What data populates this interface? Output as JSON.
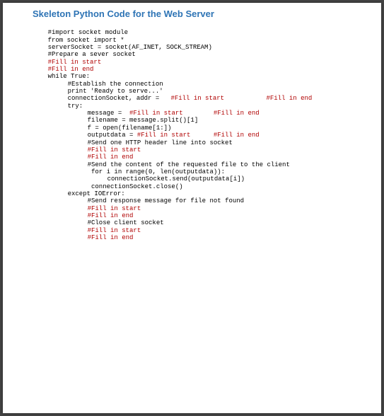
{
  "title": "Skeleton Python Code for the Web Server",
  "code": {
    "l1": "#import socket module",
    "l2": "from socket import *",
    "l3": "serverSocket = socket(AF_INET, SOCK_STREAM)",
    "l4": "#Prepare a sever socket",
    "l5": "#Fill in start",
    "l6": "#Fill in end",
    "l7": "while True:",
    "l8": "#Establish the connection",
    "l9": "print 'Ready to serve...'",
    "l10a": "connectionSocket, addr =   ",
    "l10b": "#Fill in start",
    "l10c": "           ",
    "l10d": "#Fill in end",
    "l11": "try:",
    "l12a": "message =  ",
    "l12b": "#Fill in start",
    "l12c": "        ",
    "l12d": "#Fill in end",
    "l13": "filename = message.split()[1]",
    "l14": "f = open(filename[1:])",
    "l15a": "outputdata = ",
    "l15b": "#Fill in start",
    "l15c": "      ",
    "l15d": "#Fill in end",
    "l16": "#Send one HTTP header line into socket",
    "l17": "#Fill in start",
    "l18": "#Fill in end",
    "l19": "#Send the content of the requested file to the client",
    "l20": " for i in range(0, len(outputdata)):",
    "l21": "connectionSocket.send(outputdata[i])",
    "l22": " connectionSocket.close()",
    "l23": "except IOError:",
    "l24": "#Send response message for file not found",
    "l25": "#Fill in start",
    "l26": "#Fill in end",
    "l27": "#Close client socket",
    "l28": "#Fill in start",
    "l29": "#Fill in end"
  }
}
